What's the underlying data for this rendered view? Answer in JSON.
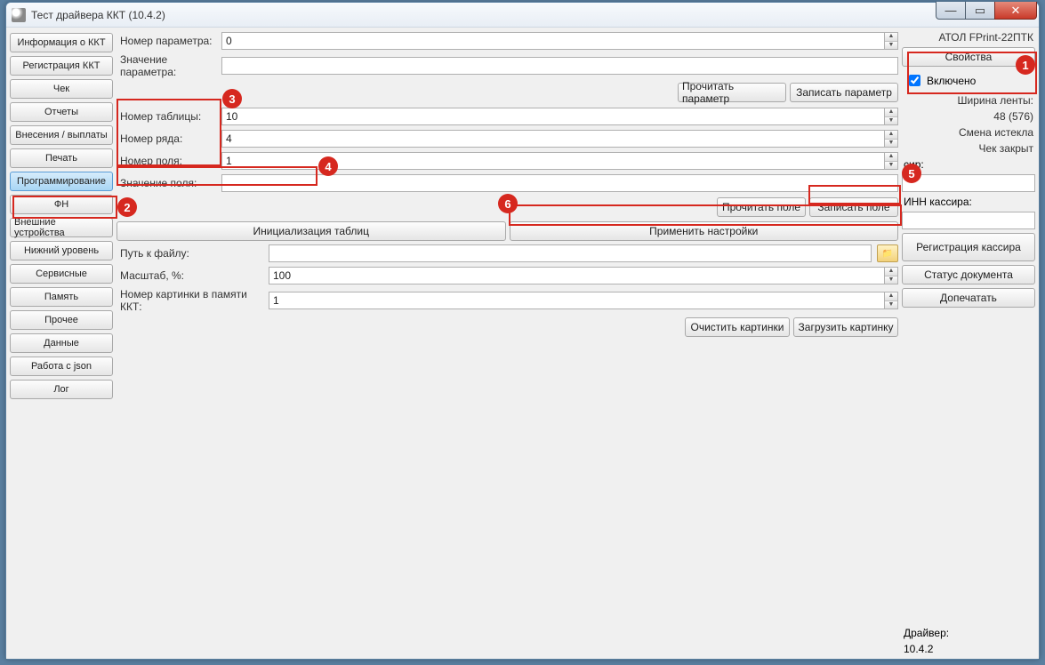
{
  "window": {
    "title": "Тест драйвера ККТ (10.4.2)"
  },
  "sidebar": {
    "items": [
      "Информация о ККТ",
      "Регистрация ККТ",
      "Чек",
      "Отчеты",
      "Внесения / выплаты",
      "Печать",
      "Программирование",
      "ФН",
      "Внешние устройства",
      "Нижний уровень",
      "Сервисные",
      "Память",
      "Прочее",
      "Данные",
      "Работа с json",
      "Лог"
    ],
    "activeIndex": "6"
  },
  "main": {
    "param_no_label": "Номер параметра:",
    "param_no_value": "0",
    "param_val_label": "Значение параметра:",
    "param_val_value": "",
    "read_param": "Прочитать параметр",
    "write_param": "Записать параметр",
    "table_no_label": "Номер таблицы:",
    "table_no_value": "10",
    "row_no_label": "Номер ряда:",
    "row_no_value": "4",
    "field_no_label": "Номер поля:",
    "field_no_value": "1",
    "field_val_label": "Значение поля:",
    "field_val_value": "",
    "read_field": "Прочитать поле",
    "write_field": "Записать поле",
    "init_tables": "Инициализация таблиц",
    "apply_settings": "Применить настройки",
    "file_path_label": "Путь к файлу:",
    "file_path_value": "",
    "scale_label": "Масштаб, %:",
    "scale_value": "100",
    "pic_no_label": "Номер картинки в памяти ККТ:",
    "pic_no_value": "1",
    "clear_pics": "Очистить картинки",
    "load_pic": "Загрузить картинку"
  },
  "right": {
    "device": "АТОЛ FPrint-22ПТК",
    "properties": "Свойства",
    "enabled_label": "Включено",
    "tape_width_label": "Ширина ленты:",
    "tape_width_value": "48 (576)",
    "shift_status": "Смена истекла",
    "check_status": "Чек закрыт",
    "cashier_suffix": "сир:",
    "cashier_inn_label": "ИНН кассира:",
    "register_cashier": "Регистрация кассира",
    "doc_status": "Статус документа",
    "reprint": "Допечатать",
    "driver_label": "Драйвер:",
    "driver_version": "10.4.2"
  }
}
